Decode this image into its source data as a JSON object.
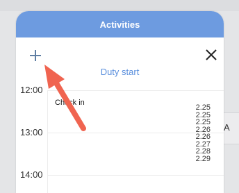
{
  "background": {
    "partial_text": "A"
  },
  "modal": {
    "title": "Activities",
    "subtitle": "Duty start",
    "add_icon": "plus-icon",
    "close_icon": "close-icon"
  },
  "timeline": {
    "hours": [
      "12:00",
      "13:00",
      "14:00"
    ],
    "event_label": "Check in",
    "values": [
      "2.25",
      "2.25",
      "2.25",
      "2.26",
      "2.26",
      "2.27",
      "2.28",
      "2.29"
    ]
  },
  "annotation": {
    "icon": "red-arrow-icon",
    "color": "#f06450"
  },
  "colors": {
    "header": "#6d9be0",
    "accent": "#5a8fdd"
  }
}
